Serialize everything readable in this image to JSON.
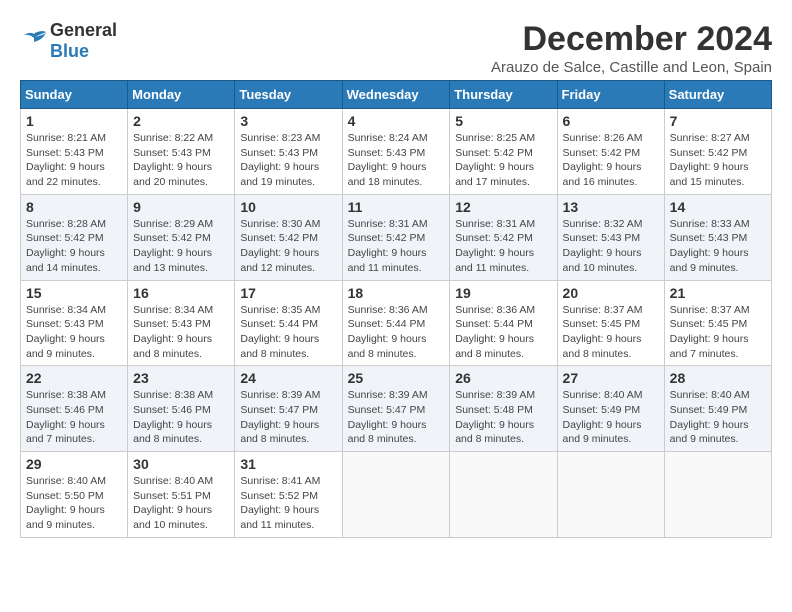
{
  "logo": {
    "general": "General",
    "blue": "Blue"
  },
  "title": "December 2024",
  "location": "Arauzo de Salce, Castille and Leon, Spain",
  "days_header": [
    "Sunday",
    "Monday",
    "Tuesday",
    "Wednesday",
    "Thursday",
    "Friday",
    "Saturday"
  ],
  "weeks": [
    [
      {
        "day": "1",
        "sunrise": "8:21 AM",
        "sunset": "5:43 PM",
        "daylight": "9 hours and 22 minutes."
      },
      {
        "day": "2",
        "sunrise": "8:22 AM",
        "sunset": "5:43 PM",
        "daylight": "9 hours and 20 minutes."
      },
      {
        "day": "3",
        "sunrise": "8:23 AM",
        "sunset": "5:43 PM",
        "daylight": "9 hours and 19 minutes."
      },
      {
        "day": "4",
        "sunrise": "8:24 AM",
        "sunset": "5:43 PM",
        "daylight": "9 hours and 18 minutes."
      },
      {
        "day": "5",
        "sunrise": "8:25 AM",
        "sunset": "5:42 PM",
        "daylight": "9 hours and 17 minutes."
      },
      {
        "day": "6",
        "sunrise": "8:26 AM",
        "sunset": "5:42 PM",
        "daylight": "9 hours and 16 minutes."
      },
      {
        "day": "7",
        "sunrise": "8:27 AM",
        "sunset": "5:42 PM",
        "daylight": "9 hours and 15 minutes."
      }
    ],
    [
      {
        "day": "8",
        "sunrise": "8:28 AM",
        "sunset": "5:42 PM",
        "daylight": "9 hours and 14 minutes."
      },
      {
        "day": "9",
        "sunrise": "8:29 AM",
        "sunset": "5:42 PM",
        "daylight": "9 hours and 13 minutes."
      },
      {
        "day": "10",
        "sunrise": "8:30 AM",
        "sunset": "5:42 PM",
        "daylight": "9 hours and 12 minutes."
      },
      {
        "day": "11",
        "sunrise": "8:31 AM",
        "sunset": "5:42 PM",
        "daylight": "9 hours and 11 minutes."
      },
      {
        "day": "12",
        "sunrise": "8:31 AM",
        "sunset": "5:42 PM",
        "daylight": "9 hours and 11 minutes."
      },
      {
        "day": "13",
        "sunrise": "8:32 AM",
        "sunset": "5:43 PM",
        "daylight": "9 hours and 10 minutes."
      },
      {
        "day": "14",
        "sunrise": "8:33 AM",
        "sunset": "5:43 PM",
        "daylight": "9 hours and 9 minutes."
      }
    ],
    [
      {
        "day": "15",
        "sunrise": "8:34 AM",
        "sunset": "5:43 PM",
        "daylight": "9 hours and 9 minutes."
      },
      {
        "day": "16",
        "sunrise": "8:34 AM",
        "sunset": "5:43 PM",
        "daylight": "9 hours and 8 minutes."
      },
      {
        "day": "17",
        "sunrise": "8:35 AM",
        "sunset": "5:44 PM",
        "daylight": "9 hours and 8 minutes."
      },
      {
        "day": "18",
        "sunrise": "8:36 AM",
        "sunset": "5:44 PM",
        "daylight": "9 hours and 8 minutes."
      },
      {
        "day": "19",
        "sunrise": "8:36 AM",
        "sunset": "5:44 PM",
        "daylight": "9 hours and 8 minutes."
      },
      {
        "day": "20",
        "sunrise": "8:37 AM",
        "sunset": "5:45 PM",
        "daylight": "9 hours and 8 minutes."
      },
      {
        "day": "21",
        "sunrise": "8:37 AM",
        "sunset": "5:45 PM",
        "daylight": "9 hours and 7 minutes."
      }
    ],
    [
      {
        "day": "22",
        "sunrise": "8:38 AM",
        "sunset": "5:46 PM",
        "daylight": "9 hours and 7 minutes."
      },
      {
        "day": "23",
        "sunrise": "8:38 AM",
        "sunset": "5:46 PM",
        "daylight": "9 hours and 8 minutes."
      },
      {
        "day": "24",
        "sunrise": "8:39 AM",
        "sunset": "5:47 PM",
        "daylight": "9 hours and 8 minutes."
      },
      {
        "day": "25",
        "sunrise": "8:39 AM",
        "sunset": "5:47 PM",
        "daylight": "9 hours and 8 minutes."
      },
      {
        "day": "26",
        "sunrise": "8:39 AM",
        "sunset": "5:48 PM",
        "daylight": "9 hours and 8 minutes."
      },
      {
        "day": "27",
        "sunrise": "8:40 AM",
        "sunset": "5:49 PM",
        "daylight": "9 hours and 9 minutes."
      },
      {
        "day": "28",
        "sunrise": "8:40 AM",
        "sunset": "5:49 PM",
        "daylight": "9 hours and 9 minutes."
      }
    ],
    [
      {
        "day": "29",
        "sunrise": "8:40 AM",
        "sunset": "5:50 PM",
        "daylight": "9 hours and 9 minutes."
      },
      {
        "day": "30",
        "sunrise": "8:40 AM",
        "sunset": "5:51 PM",
        "daylight": "9 hours and 10 minutes."
      },
      {
        "day": "31",
        "sunrise": "8:41 AM",
        "sunset": "5:52 PM",
        "daylight": "9 hours and 11 minutes."
      },
      null,
      null,
      null,
      null
    ]
  ]
}
